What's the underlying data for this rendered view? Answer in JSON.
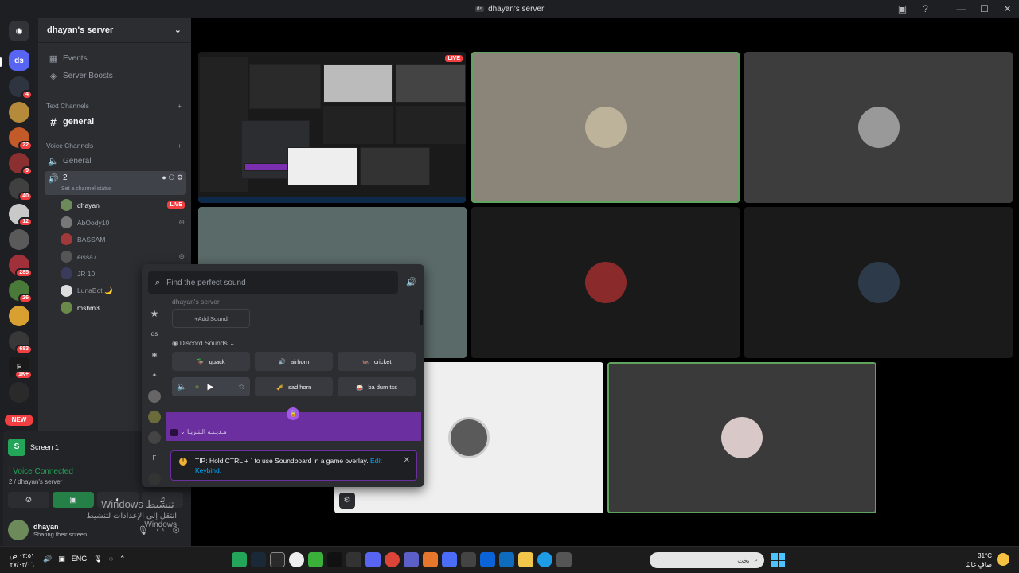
{
  "window": {
    "server_badge": "ds",
    "title": "dhayan's server"
  },
  "guild_rail": {
    "items": [
      {
        "label": "ds",
        "badge": ""
      },
      {
        "label": "",
        "badge": "4"
      },
      {
        "label": "",
        "badge": ""
      },
      {
        "label": "",
        "badge": "22"
      },
      {
        "label": "",
        "badge": "9"
      },
      {
        "label": "",
        "badge": "40"
      },
      {
        "label": "",
        "badge": "12"
      },
      {
        "label": "",
        "badge": ""
      },
      {
        "label": "",
        "badge": "285"
      },
      {
        "label": "",
        "badge": "26"
      },
      {
        "label": "",
        "badge": ""
      },
      {
        "label": "",
        "badge": "683"
      },
      {
        "label": "F",
        "badge": "1K+"
      },
      {
        "label": "",
        "badge": ""
      }
    ],
    "new_label": "NEW"
  },
  "server": {
    "name": "dhayan's server",
    "events_label": "Events",
    "boosts_label": "Server Boosts",
    "text_category": "Text Channels",
    "text_channel": "general",
    "voice_category": "Voice Channels",
    "voice_channel_general": "General",
    "voice_channel_active": "2",
    "channel_status_placeholder": "Set a channel status",
    "voice_users": [
      {
        "name": "dhayan",
        "tag": "LIVE"
      },
      {
        "name": "AbOody10",
        "tag": "ps"
      },
      {
        "name": "BASSAM",
        "tag": ""
      },
      {
        "name": "eissa7",
        "tag": "ps"
      },
      {
        "name": "JR 10",
        "tag": "ps"
      },
      {
        "name": "LunaBot 🌙",
        "tag": ""
      },
      {
        "name": "mshm3",
        "tag": ""
      }
    ]
  },
  "screen_panel": {
    "icon_letter": "S",
    "label": "Screen 1"
  },
  "voice_connected": {
    "title": "Voice Connected",
    "subtitle": "2 / dhayan's server"
  },
  "user": {
    "name": "dhayan",
    "status": "Sharing their screen"
  },
  "watermark": {
    "line1": "Windows تنشيط",
    "line2": "انتقل إلى الإعدادات لتنشيط Windows."
  },
  "stage": {
    "live_label": "LIVE"
  },
  "soundboard": {
    "search_placeholder": "Find the perfect sound",
    "server_section": "dhayan's server",
    "add_sound_label": "Add Sound",
    "discord_section": "Discord Sounds",
    "sounds": [
      {
        "label": "quack",
        "emoji": "🦆"
      },
      {
        "label": "airhorn",
        "emoji": "🔊"
      },
      {
        "label": "cricket",
        "emoji": "🦗"
      },
      {
        "label": "",
        "emoji": ""
      },
      {
        "label": "sad horn",
        "emoji": "🎺"
      },
      {
        "label": "ba dum tss",
        "emoji": "🥁"
      }
    ],
    "locked_section": "مـديـنـة الـثـريـا",
    "tip_text": "TIP: Hold CTRL + ` to use Soundboard in a game overlay.",
    "tip_link": "Edit Keybind."
  },
  "taskbar": {
    "time": "٠٣:٥١ ص",
    "date": "٢٧/٠٣/٠٦",
    "lang": "ENG",
    "search_label": "بحث",
    "temperature": "31°C",
    "weather": "صافٍ غالبًا"
  },
  "colors": {
    "accent": "#5865f2",
    "live": "#f23f42",
    "voice_green": "#23a55a",
    "speaking_outline": "#5fa35f",
    "premium_purple": "#6b2fa0"
  }
}
